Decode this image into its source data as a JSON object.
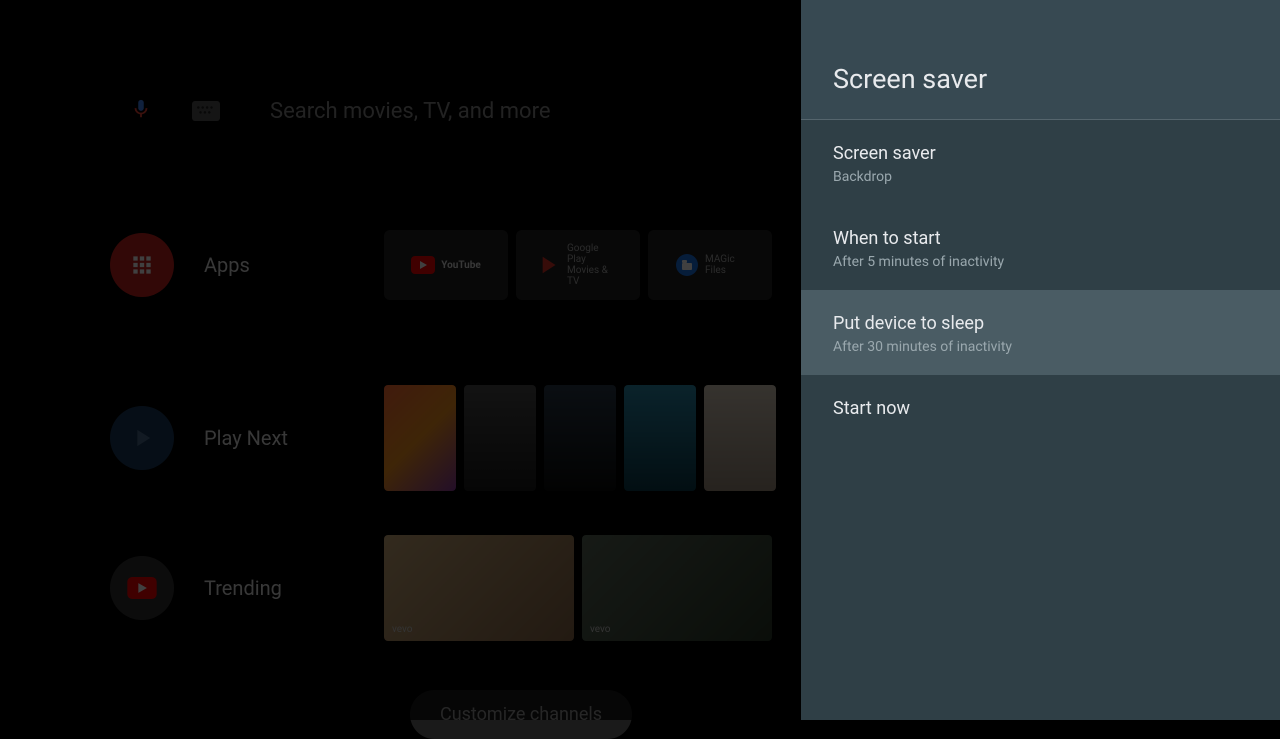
{
  "search": {
    "placeholder": "Search movies, TV, and more"
  },
  "rows": {
    "apps": {
      "label": "Apps",
      "items": [
        {
          "name": "YouTube"
        },
        {
          "name": "Google Play Movies & TV"
        },
        {
          "name": "MAGic Files"
        }
      ]
    },
    "play_next": {
      "label": "Play Next"
    },
    "trending": {
      "label": "Trending"
    }
  },
  "customize_label": "Customize channels",
  "panel": {
    "title": "Screen saver",
    "items": [
      {
        "title": "Screen saver",
        "subtitle": "Backdrop",
        "selected": false
      },
      {
        "title": "When to start",
        "subtitle": "After 5 minutes of inactivity",
        "selected": false
      },
      {
        "title": "Put device to sleep",
        "subtitle": "After 30 minutes of inactivity",
        "selected": true
      },
      {
        "title": "Start now",
        "subtitle": "",
        "selected": false
      }
    ]
  },
  "vevo_tag": "vevo"
}
